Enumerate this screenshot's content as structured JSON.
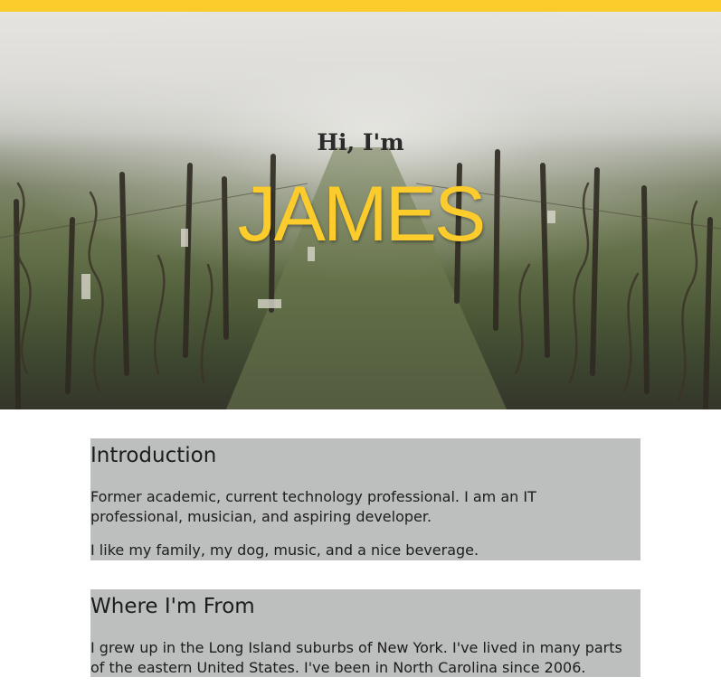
{
  "hero": {
    "greeting": "Hi, I'm",
    "name": "JAMES"
  },
  "sections": [
    {
      "heading": "Introduction",
      "paragraphs": [
        "Former academic, current technology professional. I am an IT professional, musician, and aspiring developer.",
        "I like my family, my dog, music, and a nice beverage."
      ]
    },
    {
      "heading": "Where I'm From",
      "paragraphs": [
        "I grew up in the Long Island suburbs of New York. I've lived in many parts of the eastern United States. I've been in North Carolina since 2006."
      ]
    }
  ],
  "colors": {
    "accent": "#fccb2c",
    "section_bg": "#bdbfbe"
  }
}
